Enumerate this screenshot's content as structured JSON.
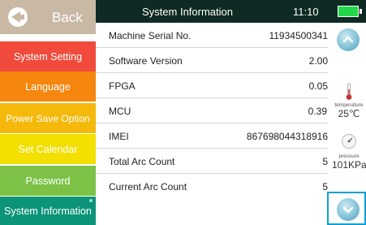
{
  "sidebar": {
    "back_label": "Back",
    "items": [
      {
        "label": "System Setting",
        "color": "#f04b3c"
      },
      {
        "label": "Language",
        "color": "#f5860e"
      },
      {
        "label": "Power Save Option",
        "color": "#f4b90a"
      },
      {
        "label": "Set Calendar",
        "color": "#f3df00"
      },
      {
        "label": "Password",
        "color": "#7cc246"
      },
      {
        "label": "System Information",
        "color": "#0c9478",
        "selected": true
      }
    ]
  },
  "header": {
    "title": "System Information",
    "time": "11:10",
    "battery_level": 1.0
  },
  "info_rows": [
    {
      "label": "Machine Serial No.",
      "value": "11934500341"
    },
    {
      "label": "Software Version",
      "value": "2.00"
    },
    {
      "label": "FPGA",
      "value": "0.05"
    },
    {
      "label": "MCU",
      "value": "0.39"
    },
    {
      "label": "IMEI",
      "value": "867698044318916"
    },
    {
      "label": "Total Arc Count",
      "value": "5"
    },
    {
      "label": "Current Arc Count",
      "value": "5"
    }
  ],
  "sensors": {
    "temperature": {
      "caption": "temperature",
      "value": "25℃",
      "icon": "thermometer-icon"
    },
    "pressure": {
      "caption": "pressure",
      "value": "101KPa",
      "icon": "gauge-icon"
    }
  },
  "scroll": {
    "up_icon": "chevron-up-icon",
    "down_icon": "chevron-down-icon"
  }
}
